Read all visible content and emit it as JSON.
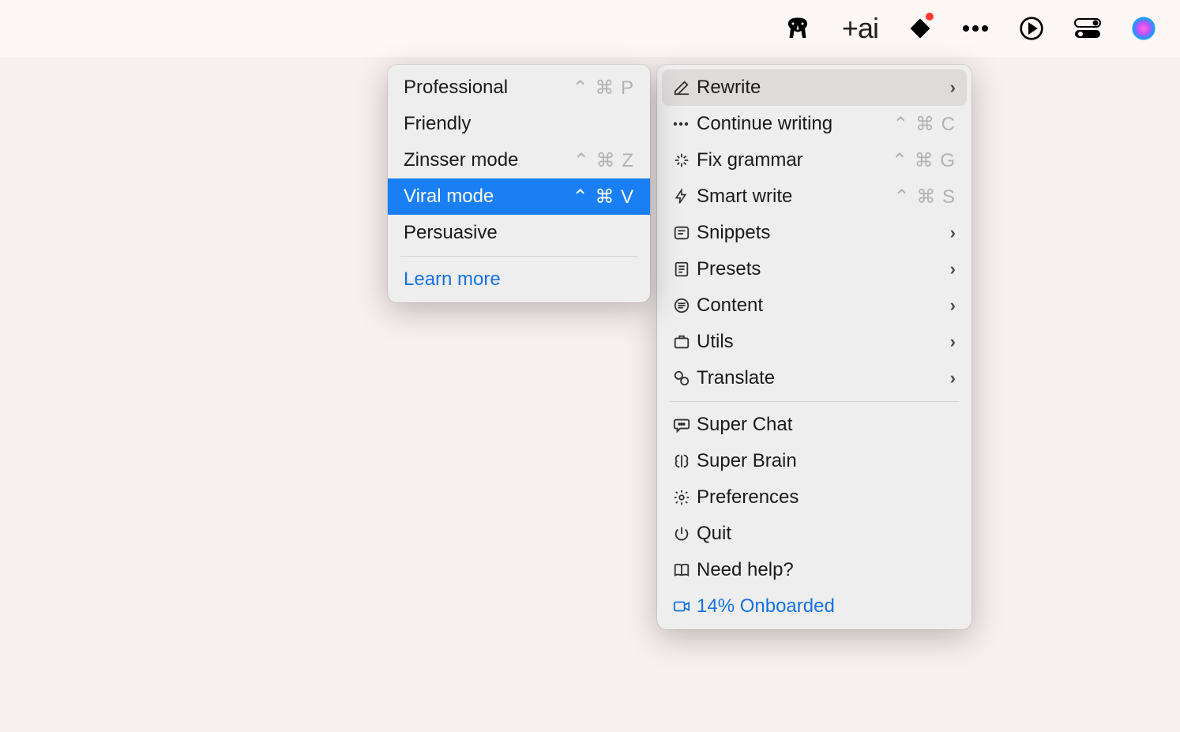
{
  "menubar": {
    "ai_label": "+ai"
  },
  "mainMenu": {
    "rewrite": "Rewrite",
    "continue_writing": "Continue writing",
    "continue_writing_sc": "⌃ ⌘ C",
    "fix_grammar": "Fix grammar",
    "fix_grammar_sc": "⌃ ⌘ G",
    "smart_write": "Smart write",
    "smart_write_sc": "⌃ ⌘ S",
    "snippets": "Snippets",
    "presets": "Presets",
    "content": "Content",
    "utils": "Utils",
    "translate": "Translate",
    "super_chat": "Super Chat",
    "super_brain": "Super Brain",
    "preferences": "Preferences",
    "quit": "Quit",
    "need_help": "Need help?",
    "onboarded": "14% Onboarded"
  },
  "subMenu": {
    "professional": "Professional",
    "professional_sc": "⌃ ⌘ P",
    "friendly": "Friendly",
    "zinsser": "Zinsser mode",
    "zinsser_sc": "⌃ ⌘ Z",
    "viral": "Viral mode",
    "viral_sc": "⌃ ⌘ V",
    "persuasive": "Persuasive",
    "learn_more": "Learn more"
  }
}
